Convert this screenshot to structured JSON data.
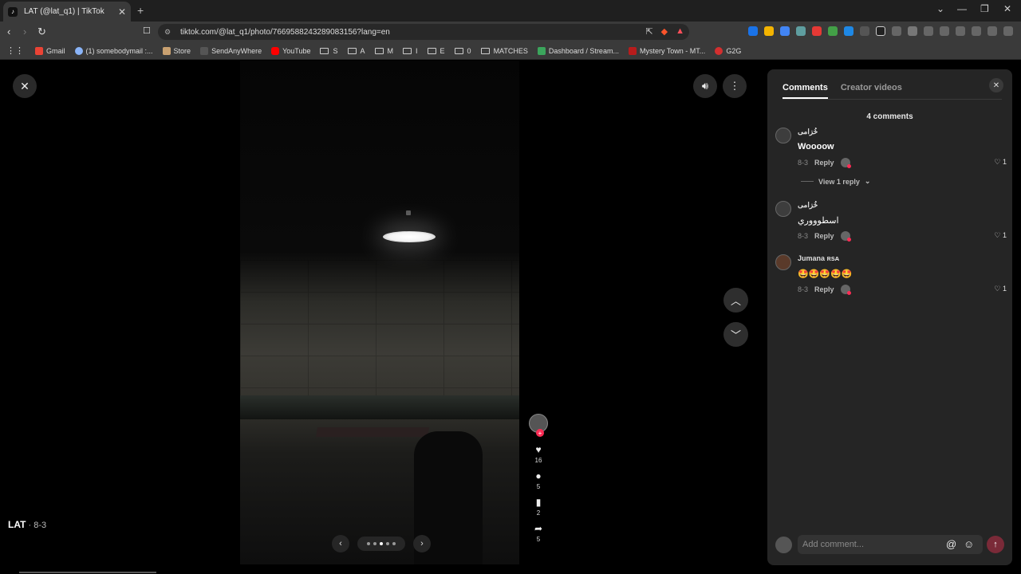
{
  "browser": {
    "tab_title": "LAT (@lat_q1) | TikTok",
    "url": "tiktok.com/@lat_q1/photo/7669588243289083156?lang=en",
    "window_controls": [
      "⌄",
      "—",
      "❐",
      "✕"
    ],
    "bookmarks": [
      {
        "label": "Gmail",
        "icon": "gmail-icon",
        "color": "#ea4335"
      },
      {
        "label": "(1) somebodymail :...",
        "icon": "bookmark-icon",
        "color": "#8ab4f8"
      },
      {
        "label": "Store",
        "icon": "store-icon",
        "color": "#c8a070"
      },
      {
        "label": "SendAnyWhere",
        "icon": "send-icon",
        "color": "#555555"
      },
      {
        "label": "YouTube",
        "icon": "youtube-icon",
        "color": "#ff0000"
      },
      {
        "label": "S",
        "icon": "folder-icon"
      },
      {
        "label": "A",
        "icon": "folder-icon"
      },
      {
        "label": "M",
        "icon": "folder-icon"
      },
      {
        "label": "I",
        "icon": "folder-icon"
      },
      {
        "label": "E",
        "icon": "folder-icon"
      },
      {
        "label": "0",
        "icon": "folder-icon"
      },
      {
        "label": "MATCHES",
        "icon": "folder-icon"
      },
      {
        "label": "Dashboard / Stream...",
        "icon": "dashboard-icon",
        "color": "#3ba55c"
      },
      {
        "label": "Mystery Town - MT...",
        "icon": "mystery-icon",
        "color": "#b71c1c"
      },
      {
        "label": "G2G",
        "icon": "g2g-icon",
        "color": "#d32f2f"
      }
    ]
  },
  "viewer": {
    "author_name": "LAT",
    "author_date": " · 8-3",
    "actions": {
      "likes": "16",
      "comments": "5",
      "bookmarks": "2",
      "shares": "5"
    }
  },
  "panel": {
    "tabs": [
      "Comments",
      "Creator videos"
    ],
    "comment_count": "4 comments",
    "comments": [
      {
        "name": "خُزامى",
        "text": "Woooow",
        "date": "8-3",
        "reply": "Reply",
        "likes": "1",
        "view_replies": "View 1 reply"
      },
      {
        "name": "خُزامى",
        "text": "اسطوووري",
        "date": "8-3",
        "reply": "Reply",
        "likes": "1"
      },
      {
        "name": "Jumana ʀsᴀ",
        "text": "🤩🤩🤩🤩🤩",
        "date": "8-3",
        "reply": "Reply",
        "likes": "1"
      }
    ],
    "input_placeholder": "Add comment..."
  },
  "colors": {
    "accent": "#fe2c55",
    "panel_bg": "#252525"
  }
}
